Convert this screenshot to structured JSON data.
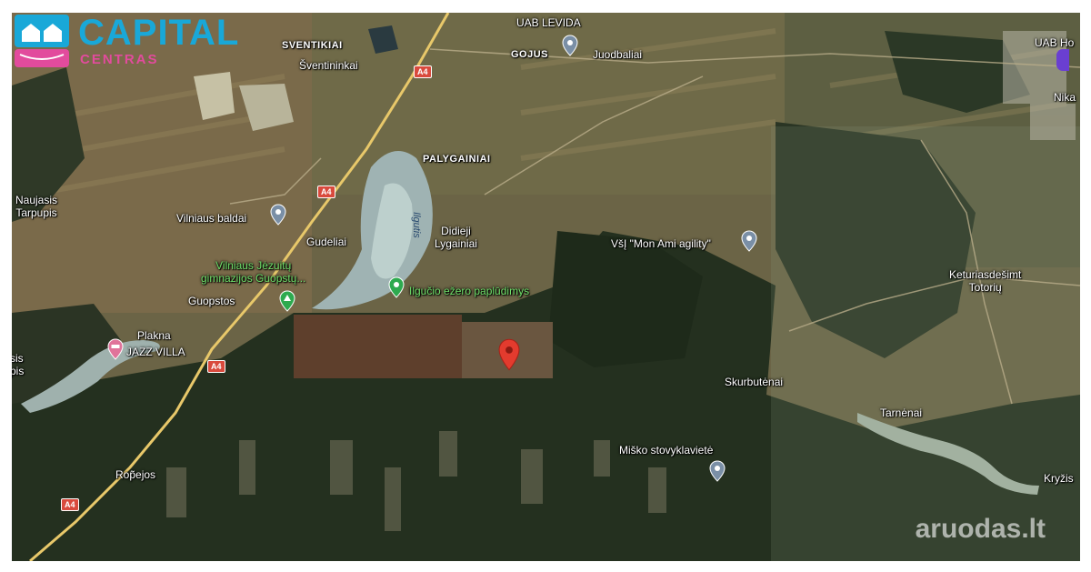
{
  "logo": {
    "brand": "CAPITAL",
    "sub": "CENTRAS"
  },
  "watermark": "aruodas.lt",
  "roads": {
    "a4": "A4"
  },
  "labels": {
    "uab_levida": "UAB LEVIDA",
    "sventikiai": "SVENTIKIAI",
    "gojus": "GOJUS",
    "juodbaliai": "Juodbaliai",
    "sventininkai": "Šventininkai",
    "uab_ho": "UAB Ho",
    "nika": "Nika",
    "palygainiai": "PALYGAINIAI",
    "naujasis_tarpupis": "Naujasis\nTarpupis",
    "vilniaus_baldai": "Vilniaus baldai",
    "ilgutis": "Ilgutis",
    "didieji_lygainiai": "Didieji\nLygainiai",
    "mon_ami": "VšĮ \"Mon Ami agility\"",
    "gudeliai": "Gudeliai",
    "jezuitu": "Vilniaus Jėzuitų\ngimnazijos Guopstų...",
    "ilgucio": "Ilgučio ežero paplūdimys",
    "guopstos": "Guopstos",
    "keturiasdesimt": "Keturiasdešimt\nTotorių",
    "plakna": "Plakna",
    "jazz_villa": "JAZZ VILLA",
    "sis_pis": "sis\npis",
    "skurbutenai": "Skurbutėnai",
    "tarnenai": "Tarnėnai",
    "misko": "Miško stovyklavietė",
    "ropejos": "Rop̃ejos",
    "kryzis": "Kryžis"
  },
  "colors": {
    "accent": "#19a8d8",
    "brand_pink": "#e24b9d",
    "pin_red": "#e33b2e",
    "road": "#d94a3d",
    "green_label": "#6fe06a"
  },
  "icons": [
    "map-pin-icon",
    "green-pin-icon",
    "campsite-icon",
    "hotel-icon",
    "target-marker-icon"
  ]
}
